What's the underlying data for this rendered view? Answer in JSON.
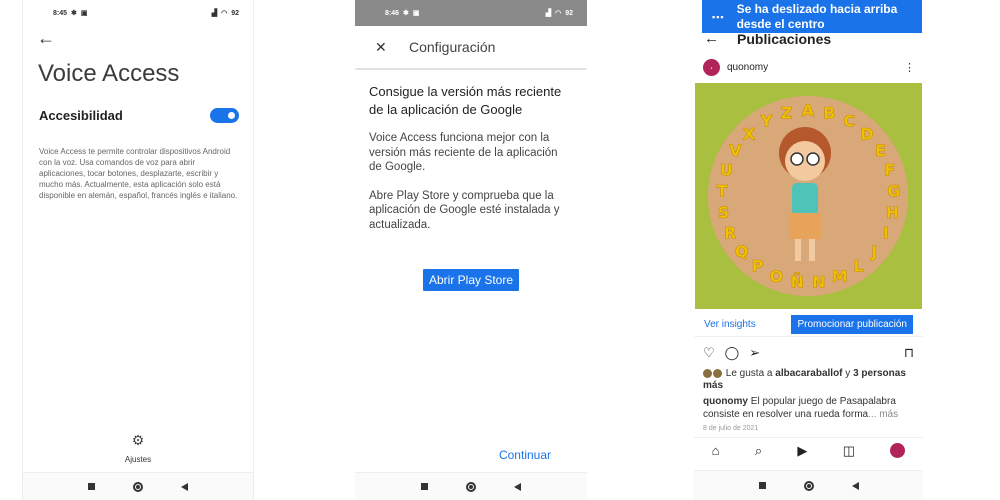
{
  "phone1": {
    "status": {
      "time": "8:45",
      "battery": "92"
    },
    "title": "Voice Access",
    "setting_label": "Accesibilidad",
    "toggle_on": true,
    "description": "Voice Access te permite controlar dispositivos Android con la voz. Usa comandos de voz para abrir aplicaciones, tocar botones, desplazarte, escribir y mucho más. Actualmente, esta aplicación solo está disponible en alemán, español, francés inglés e italiano.",
    "settings_label": "Ajustes",
    "icons": {
      "back": "back-arrow-icon",
      "settings": "gear-icon"
    }
  },
  "phone2": {
    "status": {
      "time": "8:46",
      "battery": "92"
    },
    "appbar_title": "Configuración",
    "heading": "Consigue la versión más reciente de la aplicación de Google",
    "para1": "Voice Access funciona mejor con la versión más reciente de la aplicación de Google.",
    "para2": "Abre Play Store y comprueba que la aplicación de Google esté instalada y actualizada.",
    "play_button": "Abrir Play Store",
    "continue_button": "Continuar",
    "accent": "#1a73e8"
  },
  "phone3": {
    "toast": "Se ha deslizado hacia arriba desde el centro",
    "header_title": "Publicaciones",
    "username": "quonomy",
    "insights": "Ver insights",
    "promote": "Promocionar publicación",
    "likes_prefix": "Le gusta a ",
    "likes_user": "albacaraballof",
    "likes_connector": " y ",
    "likes_others": "3 personas más",
    "caption_user": "quonomy",
    "caption_text": " El popular juego de Pasapalabra consiste en resolver una rueda forma",
    "caption_more": "... más",
    "date": "8 de julio de 2021",
    "letters": [
      "A",
      "B",
      "C",
      "D",
      "E",
      "F",
      "G",
      "H",
      "I",
      "J",
      "L",
      "M",
      "N",
      "Ñ",
      "O",
      "P",
      "Q",
      "R",
      "S",
      "T",
      "U",
      "V",
      "X",
      "Y",
      "Z"
    ],
    "brand_color": "#b0245a"
  }
}
